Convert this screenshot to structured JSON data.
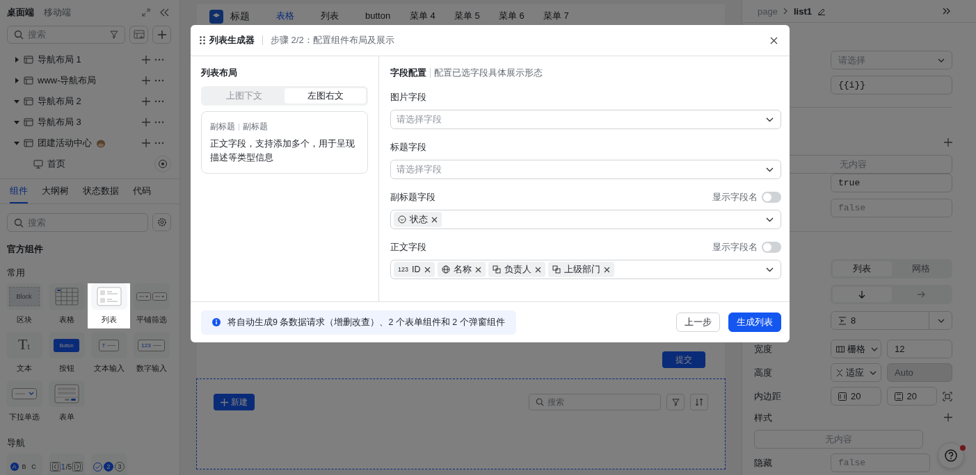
{
  "left_panel": {
    "platform_tabs": [
      {
        "label": "桌面端",
        "selected": true
      },
      {
        "label": "移动端",
        "selected": false
      }
    ],
    "page_search": {
      "placeholder": "搜索"
    },
    "tree": [
      {
        "label": "导航布局 1",
        "kind": "layout",
        "expanded": false,
        "emoji_icon": false
      },
      {
        "label": "www-导航布局",
        "kind": "layout",
        "expanded": false,
        "emoji_icon": false
      },
      {
        "label": "导航布局 2",
        "kind": "layout",
        "expanded": true,
        "emoji_icon": false
      },
      {
        "label": "导航布局 3",
        "kind": "layout",
        "expanded": true,
        "emoji_icon": false
      },
      {
        "label": "团建活动中心",
        "kind": "layout",
        "expanded": true,
        "emoji_icon": true,
        "children": [
          {
            "label": "首页",
            "kind": "page"
          }
        ]
      }
    ],
    "panel_tabs": [
      {
        "label": "组件",
        "selected": true
      },
      {
        "label": "大纲树",
        "selected": false
      },
      {
        "label": "状态数据",
        "selected": false
      },
      {
        "label": "代码",
        "selected": false
      }
    ],
    "component_search": {
      "placeholder": "搜索"
    },
    "library_title": "官方组件",
    "groups": [
      {
        "title": "常用",
        "items": [
          {
            "label": "区块",
            "kind": "block",
            "preview_texts": [
              "Block"
            ],
            "selected": false
          },
          {
            "label": "表格",
            "kind": "table",
            "selected": false
          },
          {
            "label": "列表",
            "kind": "list",
            "selected": true
          },
          {
            "label": "平铺筛选",
            "kind": "filter",
            "selected": false
          },
          {
            "label": "文本",
            "kind": "text",
            "preview_texts": [
              "T",
              "t"
            ],
            "selected": false
          },
          {
            "label": "按钮",
            "kind": "button",
            "preview_texts": [
              "Button"
            ],
            "selected": false
          },
          {
            "label": "文本输入",
            "kind": "text-input",
            "preview_texts": [
              "T"
            ],
            "selected": false
          },
          {
            "label": "数字输入",
            "kind": "number-input",
            "preview_texts": [
              "123"
            ],
            "selected": false
          },
          {
            "label": "下拉单选",
            "kind": "select",
            "selected": false
          },
          {
            "label": "表单",
            "kind": "form",
            "selected": false
          }
        ]
      },
      {
        "title": "导航",
        "items": [
          {
            "kind": "tabs",
            "preview_texts": [
              "A",
              "B",
              "C"
            ],
            "selected": false
          },
          {
            "kind": "pager",
            "preview_texts": [
              "1",
              "/",
              "5"
            ],
            "selected": false
          },
          {
            "kind": "steps",
            "preview_texts": [
              "2",
              "3"
            ],
            "selected": false
          }
        ]
      }
    ]
  },
  "canvas": {
    "nav_bar": {
      "title": "标题",
      "items": [
        {
          "label": "表格",
          "selected": true
        },
        {
          "label": "列表",
          "selected": false
        },
        {
          "label": "button",
          "selected": false
        },
        {
          "label": "菜单 4",
          "selected": false
        },
        {
          "label": "菜单 5",
          "selected": false
        },
        {
          "label": "菜单 6",
          "selected": false
        },
        {
          "label": "菜单 7",
          "selected": false
        }
      ]
    },
    "submit_button": "提交",
    "new_button": "新建",
    "list_search": {
      "placeholder": "搜索"
    }
  },
  "right_panel": {
    "breadcrumb": [
      "page",
      "list1"
    ],
    "source": {
      "select_placeholder": "请选择",
      "key_value": "{{i}}"
    },
    "events": {
      "empty": "无内容",
      "fields": [
        {
          "value": "true"
        },
        {
          "placeholder": "false"
        }
      ]
    },
    "layout_mode": [
      {
        "label": "列表",
        "selected": true
      },
      {
        "label": "网格",
        "selected": false
      }
    ],
    "direction": [
      {
        "kind": "down",
        "selected": true
      },
      {
        "kind": "right",
        "selected": false
      }
    ],
    "spacing": {
      "value": "8"
    },
    "width": {
      "label": "宽度",
      "unit": "栅格",
      "value": "12"
    },
    "height": {
      "label": "高度",
      "unit": "适应",
      "placeholder": "Auto",
      "disabled": true
    },
    "padding": {
      "label": "内边距",
      "values": [
        "20",
        "20"
      ]
    },
    "style": {
      "label": "样式",
      "empty": "无内容"
    },
    "hidden": {
      "label": "隐藏",
      "placeholder": "false"
    },
    "help": {
      "notification": true
    }
  },
  "modal": {
    "title": "列表生成器",
    "step": "步骤 2/2：配置组件布局及展示",
    "layout": {
      "title": "列表布局",
      "options": [
        {
          "label": "上图下文",
          "selected": false
        },
        {
          "label": "左图右文",
          "selected": true
        }
      ],
      "preview": {
        "subtitles": [
          "副标题",
          "副标题"
        ],
        "body": "正文字段，支持添加多个，用于呈现描述等类型信息"
      }
    },
    "fields": {
      "title": "字段配置",
      "description": "配置已选字段具体展示形态",
      "items": [
        {
          "label": "图片字段",
          "placeholder": "请选择字段"
        },
        {
          "label": "标题字段",
          "placeholder": "请选择字段"
        },
        {
          "label": "副标题字段",
          "show_name_label": "显示字段名",
          "show_name": false,
          "tags": [
            {
              "label": "状态",
              "kind": "status"
            }
          ]
        },
        {
          "label": "正文字段",
          "show_name_label": "显示字段名",
          "show_name": false,
          "tags": [
            {
              "label": "ID",
              "kind": "number",
              "icon_text": "123"
            },
            {
              "label": "名称",
              "kind": "globe"
            },
            {
              "label": "负责人",
              "kind": "relation"
            },
            {
              "label": "上级部门",
              "kind": "relation"
            }
          ]
        }
      ]
    },
    "notice": "将自动生成9 条数据请求（增删改查）、2 个表单组件和 2 个弹窗组件",
    "buttons": [
      {
        "label": "上一步",
        "kind": "secondary"
      },
      {
        "label": "生成列表",
        "kind": "primary"
      }
    ]
  }
}
